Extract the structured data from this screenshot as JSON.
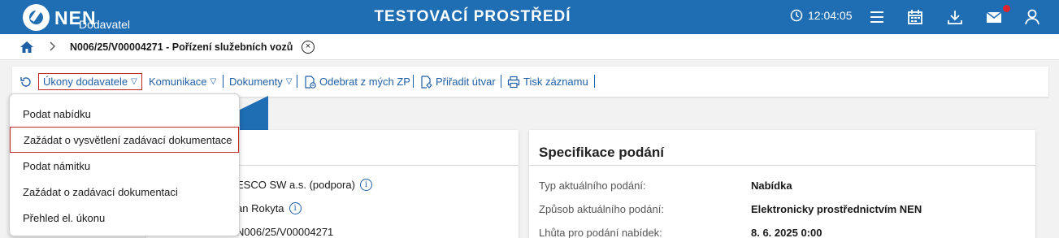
{
  "header": {
    "logo_text": "NEN",
    "logo_sub": "Dodavatel",
    "environment": "TESTOVACÍ PROSTŘEDÍ",
    "clock": "12:04:05",
    "icons": [
      "clock-icon",
      "menu-icon",
      "calendar-icon",
      "download-icon",
      "mail-icon",
      "user-icon"
    ],
    "brand_color": "#1f6db3",
    "notification_color": "#e0242f"
  },
  "breadcrumb": {
    "title": "N006/25/V00004271 - Pořízení služebních vozů",
    "close": "×"
  },
  "toolbar": {
    "ukony": "Úkony dodavatele",
    "komunikace": "Komunikace",
    "dokumenty": "Dokumenty",
    "odebrat": "Odebrat z mých ZP",
    "priradit": "Přiřadit útvar",
    "tisk": "Tisk záznamu",
    "caret": "▽"
  },
  "dropdown": {
    "items": [
      "Podat nabídku",
      "Zažádat o vysvětlení zadávací dokumentace",
      "Podat námitku",
      "Zažádat o zadávací dokumentaci",
      "Přehled el. úkonu"
    ]
  },
  "left_panel": {
    "rows": [
      "ESCO SW a.s. (podpora)",
      "an Rokyta",
      "N006/25/V00004271"
    ]
  },
  "right_panel": {
    "title": "Specifikace podání",
    "rows": [
      {
        "label": "Typ aktuálního podání:",
        "value": "Nabídka"
      },
      {
        "label": "Způsob aktuálního podání:",
        "value": "Elektronicky prostřednictvím NEN"
      },
      {
        "label": "Lhůta pro podání nabídek:",
        "value": "8. 6. 2025 0:00"
      }
    ]
  }
}
